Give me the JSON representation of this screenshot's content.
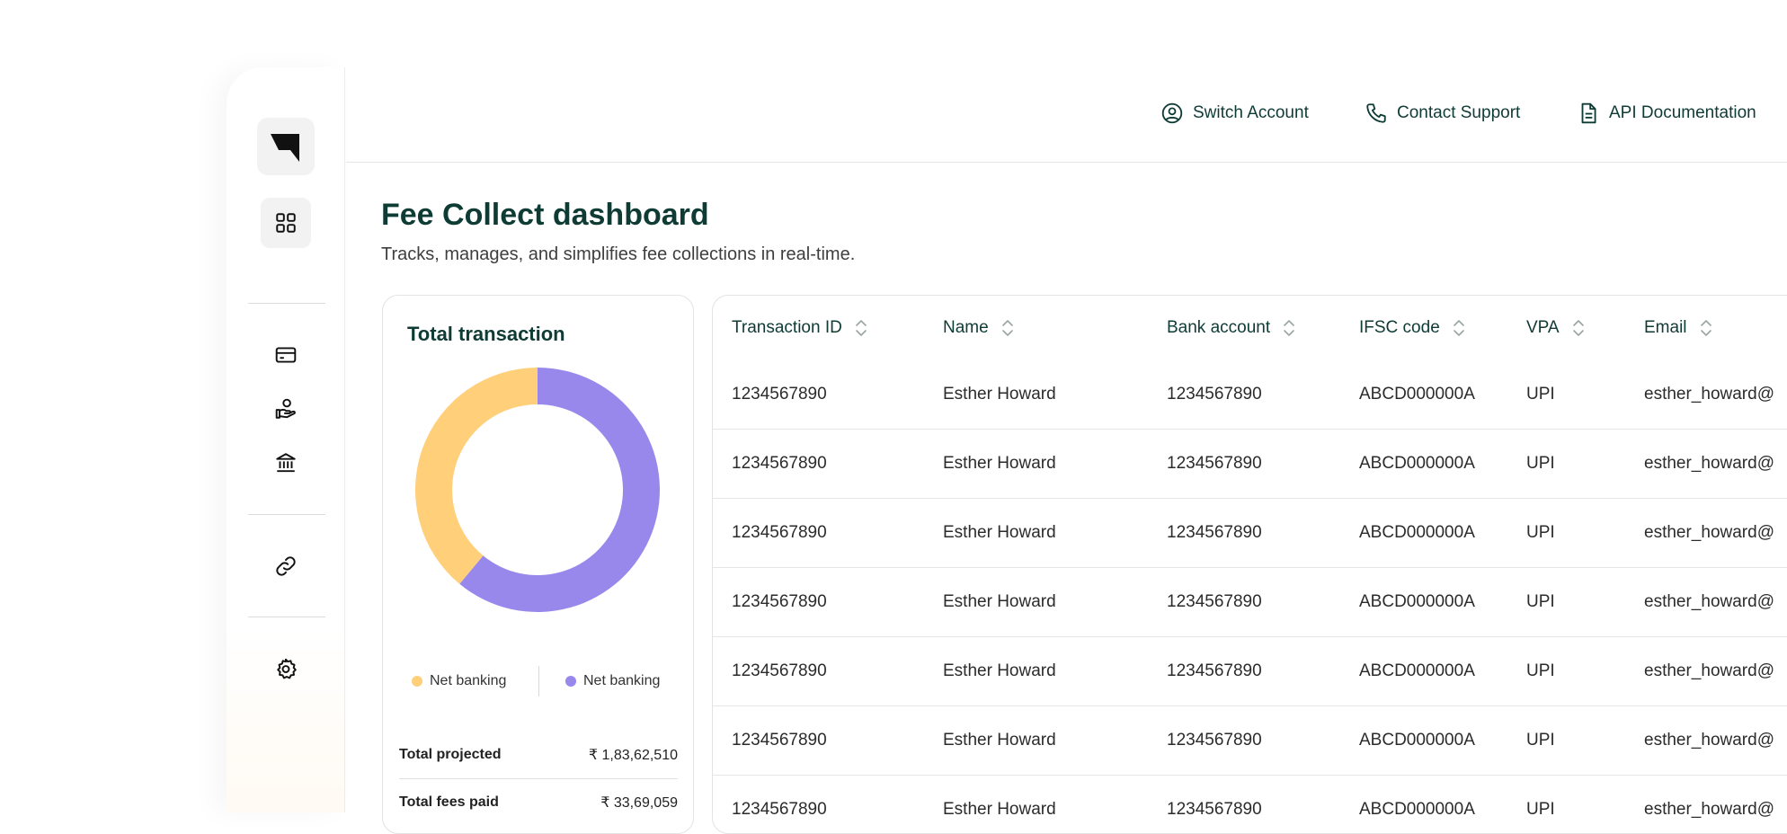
{
  "header": {
    "links": [
      {
        "label": "Switch Account",
        "icon": "user-circle-icon"
      },
      {
        "label": "Contact Support",
        "icon": "phone-icon"
      },
      {
        "label": "API Documentation",
        "icon": "document-icon"
      }
    ]
  },
  "sidebar": {
    "icons": [
      "logo-icon",
      "dashboard-grid-icon",
      "credit-card-icon",
      "hand-coin-icon",
      "bank-icon",
      "link-icon",
      "settings-gear-icon"
    ]
  },
  "page": {
    "title": "Fee Collect dashboard",
    "subtitle": "Tracks, manages, and simplifies fee collections in real-time."
  },
  "summary_card": {
    "title": "Total transaction",
    "legend": [
      {
        "label": "Net banking",
        "color": "#FFCF7A"
      },
      {
        "label": "Net banking",
        "color": "#9888EC"
      }
    ],
    "rows": [
      {
        "label": "Total projected",
        "value": "₹ 1,83,62,510"
      },
      {
        "label": "Total fees paid",
        "value": "₹ 33,69,059"
      }
    ]
  },
  "chart_data": {
    "type": "pie",
    "donut": true,
    "slices": [
      {
        "label": "Net banking",
        "value": 0.61,
        "color": "#9888EC"
      },
      {
        "label": "Net banking",
        "value": 0.39,
        "color": "#FFCF7A"
      }
    ]
  },
  "table": {
    "columns": [
      "Transaction ID",
      "Name",
      "Bank account",
      "IFSC code",
      "VPA",
      "Email"
    ],
    "rows": [
      [
        "1234567890",
        "Esther Howard",
        "1234567890",
        "ABCD000000A",
        "UPI",
        "esther_howard@"
      ],
      [
        "1234567890",
        "Esther Howard",
        "1234567890",
        "ABCD000000A",
        "UPI",
        "esther_howard@"
      ],
      [
        "1234567890",
        "Esther Howard",
        "1234567890",
        "ABCD000000A",
        "UPI",
        "esther_howard@"
      ],
      [
        "1234567890",
        "Esther Howard",
        "1234567890",
        "ABCD000000A",
        "UPI",
        "esther_howard@"
      ],
      [
        "1234567890",
        "Esther Howard",
        "1234567890",
        "ABCD000000A",
        "UPI",
        "esther_howard@"
      ],
      [
        "1234567890",
        "Esther Howard",
        "1234567890",
        "ABCD000000A",
        "UPI",
        "esther_howard@"
      ],
      [
        "1234567890",
        "Esther Howard",
        "1234567890",
        "ABCD000000A",
        "UPI",
        "esther_howard@"
      ]
    ]
  },
  "colors": {
    "primary_text": "#0F3B35",
    "accent_yellow": "#FFCF7A",
    "accent_purple": "#9888EC"
  }
}
